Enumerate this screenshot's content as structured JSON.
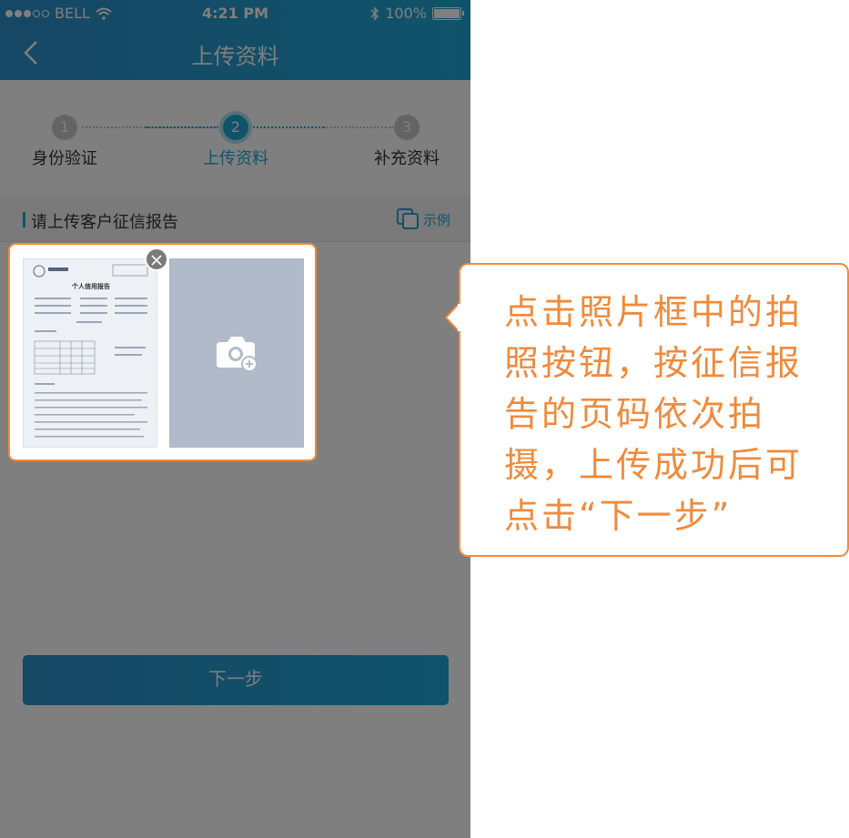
{
  "status_bar": {
    "carrier": "BELL",
    "time": "4:21 PM",
    "battery": "100%"
  },
  "nav": {
    "title": "上传资料"
  },
  "steps": [
    {
      "number": "1",
      "label": "身份验证"
    },
    {
      "number": "2",
      "label": "上传资料"
    },
    {
      "number": "3",
      "label": "补充资料"
    }
  ],
  "section": {
    "title": "请上传客户征信报告",
    "sample_label": "示例"
  },
  "document": {
    "title": "个人信用报告"
  },
  "next_button": {
    "label": "下一步"
  },
  "callout": {
    "text": "点击照片框中的拍照按钮，按征信报告的页码依次拍摄，上传成功后可点击“下一步”"
  },
  "colors": {
    "brand": "#1fa7d4",
    "accent": "#f08a3c"
  }
}
